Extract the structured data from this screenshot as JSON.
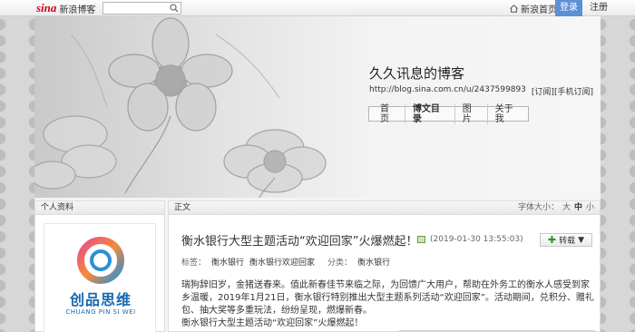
{
  "topbar": {
    "logo_brand": "sina",
    "logo_text": "新浪博客",
    "search": {
      "placeholder": "",
      "icon": "search-icon"
    },
    "home_link": "新浪首页",
    "home_icon": "home-icon",
    "login_label": "登录",
    "register_label": "注册",
    "accent_color": "#5b8fd6"
  },
  "header": {
    "blog_title": "久久讯息的博客",
    "blog_url": "http://blog.sina.com.cn/u/2437599893",
    "subscribe": "[订阅]",
    "mobile_subscribe": "[手机订阅]",
    "nav": [
      {
        "label": "首页",
        "active": false
      },
      {
        "label": "博文目录",
        "active": true
      },
      {
        "label": "图片",
        "active": false
      },
      {
        "label": "关于我",
        "active": false
      }
    ]
  },
  "sidebar": {
    "title": "个人资料",
    "avatar_cn": "创品思维",
    "avatar_en": "CHUANG PIN SI WEI"
  },
  "post": {
    "section_label": "正文",
    "font_size_label": "字体大小：",
    "font_sizes": [
      "大",
      "中",
      "小"
    ],
    "title": "衡水银行大型主题活动“欢迎回家”火爆燃起！",
    "date": "(2019-01-30 13:55:03)",
    "repost_label": "转载",
    "tags_label": "标签：",
    "tags": [
      "衡水银行",
      "衡水银行欢迎回家"
    ],
    "category_label": "分类：",
    "category": "衡水银行",
    "body_1": "瑞狗辞旧岁，金猪送春来。值此新春佳节来临之际，为回馈广大用户，帮助在外务工的衡水人感受到家乡温暖，2019年1月21日，衡水银行特别推出大型主题系列活动“欢迎回家”。活动期间，兑积分、赠礼包、抽大奖等多重玩法，纷纷呈现，燃爆新春。",
    "body_2": "衡水银行大型主题活动“欢迎回家”火爆燃起！"
  }
}
